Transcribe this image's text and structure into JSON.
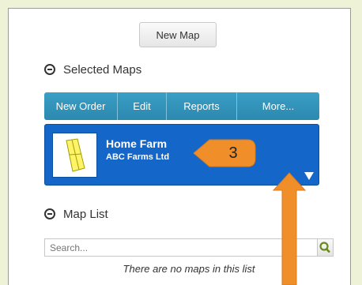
{
  "new_map_label": "New Map",
  "selected_maps": {
    "heading": "Selected Maps",
    "toolbar": [
      "New Order",
      "Edit",
      "Reports",
      "More..."
    ],
    "card": {
      "title": "Home Farm",
      "subtitle": "ABC Farms Ltd"
    }
  },
  "annotation": {
    "number": "3",
    "color": "#f08f2a"
  },
  "map_list": {
    "heading": "Map List",
    "search_placeholder": "Search...",
    "empty_message": "There are no maps in this list"
  },
  "colors": {
    "toolbar": "#2f8fb8",
    "selected_card": "#1467c8",
    "background": "#eef2d6"
  }
}
